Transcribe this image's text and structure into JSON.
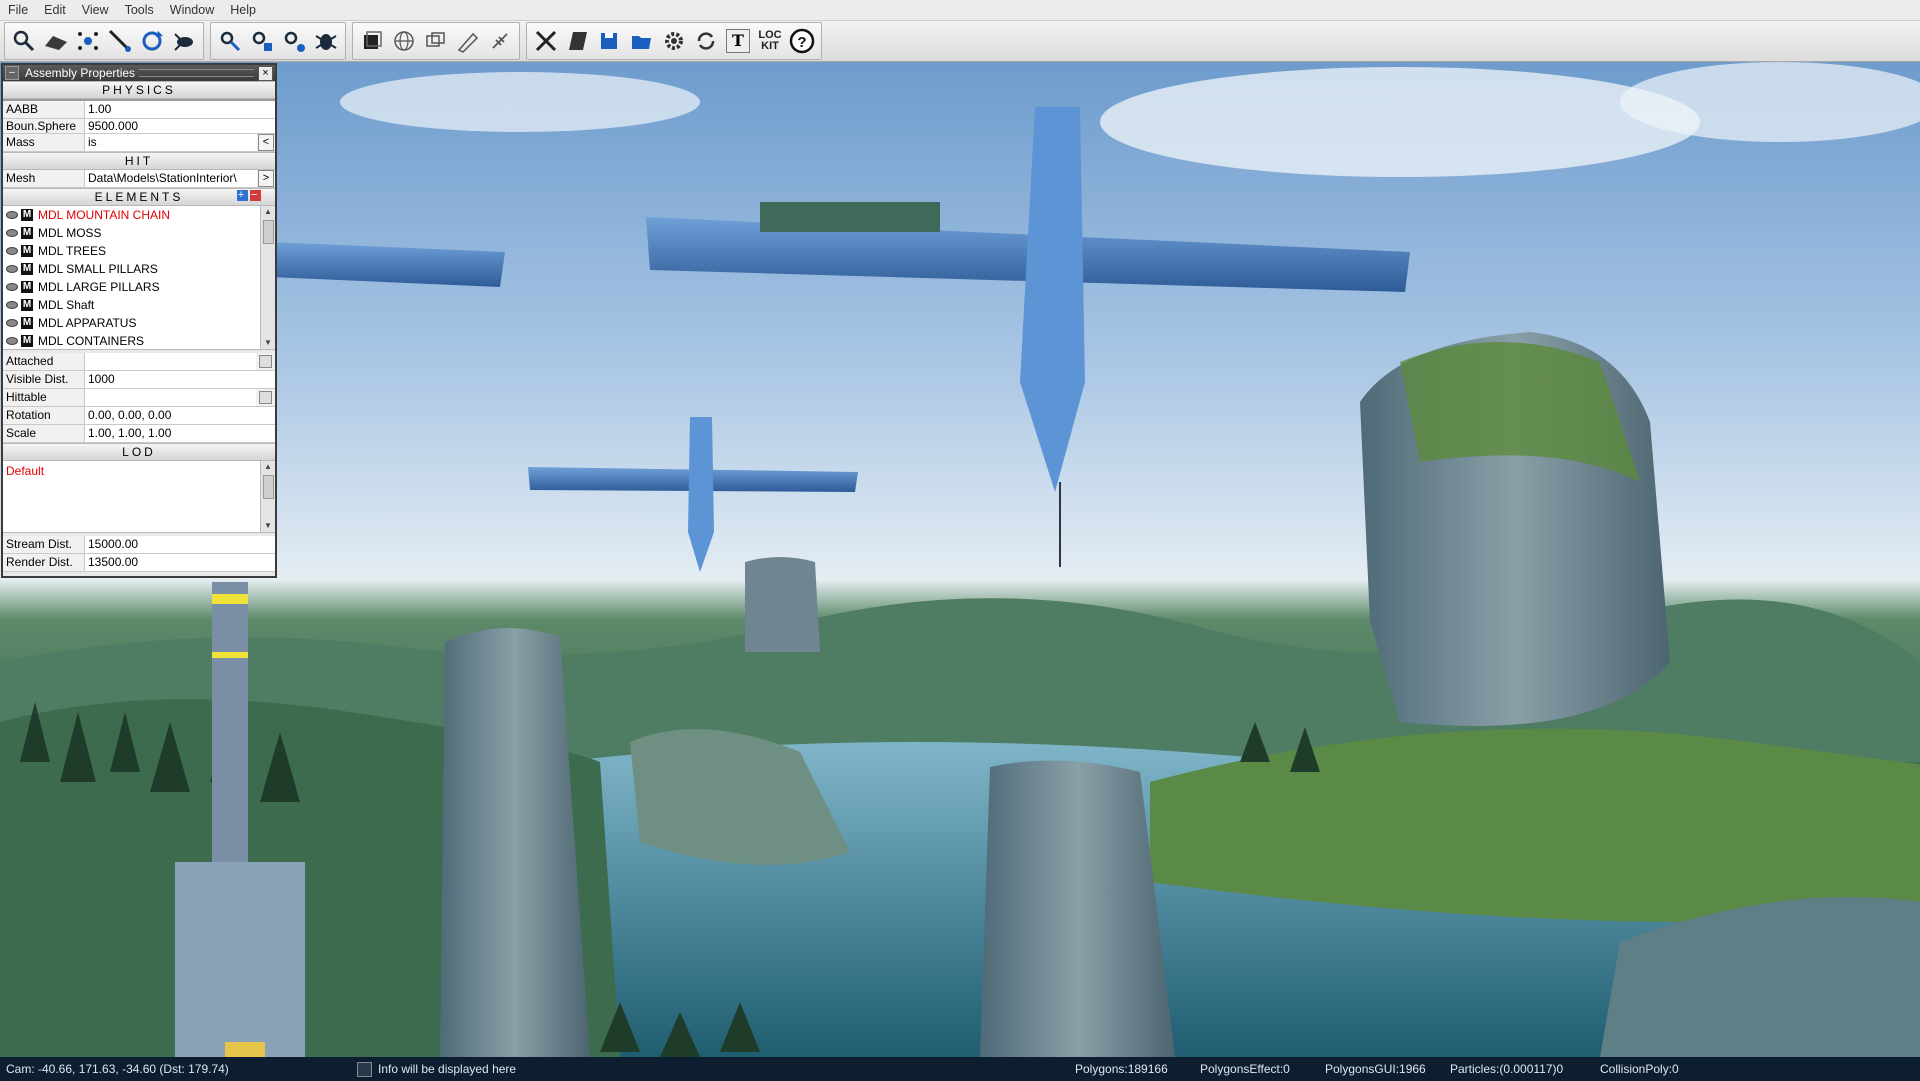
{
  "menu": [
    "File",
    "Edit",
    "View",
    "Tools",
    "Window",
    "Help"
  ],
  "toolbar": {
    "groups": [
      [
        "select-tool-icon",
        "terrain-tool-icon",
        "particle-tool-icon",
        "snap-tool-icon",
        "rotate-tool-icon",
        "creature-tool-icon"
      ],
      [
        "transform-tool-icon",
        "scale-tool-icon",
        "link-tool-icon",
        "debug-tool-icon"
      ],
      [
        "box-icon",
        "globe-icon",
        "layers-icon",
        "brush-icon",
        "tree-icon"
      ],
      [
        "tools-icon",
        "notes-icon",
        "save-icon",
        "open-folder-icon",
        "settings-gear-icon",
        "refresh-icon",
        "text-tool-icon",
        "loc-kit-icon",
        "help-icon"
      ]
    ],
    "loc_kit_line1": "LOC",
    "loc_kit_line2": "KIT",
    "text_tool_glyph": "T"
  },
  "panel": {
    "title": "Assembly Properties",
    "minimize": "–",
    "close": "×",
    "physics_header": "PHYSICS",
    "aabb_label": "AABB",
    "aabb_value": "1.00",
    "bound_sphere_label": "Boun.Sphere",
    "bound_sphere_value": "9500.000",
    "mass_label": "Mass",
    "mass_value": "is",
    "mass_button": "<",
    "hit_header": "HIT",
    "mesh_label": "Mesh",
    "mesh_value": "Data\\Models\\StationInterior\\",
    "mesh_button": ">",
    "elements_header": "ELEMENTS",
    "elements": [
      {
        "label": "MDL MOUNTAIN CHAIN",
        "selected": true
      },
      {
        "label": "MDL MOSS",
        "selected": false
      },
      {
        "label": "MDL TREES",
        "selected": false
      },
      {
        "label": "MDL SMALL PILLARS",
        "selected": false
      },
      {
        "label": "MDL LARGE PILLARS",
        "selected": false
      },
      {
        "label": "MDL Shaft",
        "selected": false
      },
      {
        "label": "MDL APPARATUS",
        "selected": false
      },
      {
        "label": "MDL CONTAINERS",
        "selected": false
      }
    ],
    "attached_label": "Attached",
    "visible_dist_label": "Visible Dist.",
    "visible_dist_value": "1000",
    "hittable_label": "Hittable",
    "rotation_label": "Rotation",
    "rotation_value": "0.00, 0.00, 0.00",
    "scale_label": "Scale",
    "scale_value": "1.00, 1.00, 1.00",
    "lod_header": "LOD",
    "lod_default": "Default",
    "stream_dist_label": "Stream Dist.",
    "stream_dist_value": "15000.00",
    "render_dist_label": "Render Dist.",
    "render_dist_value": "13500.00"
  },
  "status": {
    "cam": "Cam: -40.66, 171.63, -34.60 (Dst: 179.74)",
    "info": "Info will be displayed here",
    "polygons": "Polygons:189166",
    "polygons_effect": "PolygonsEffect:0",
    "polygons_gui": "PolygonsGUI:1966",
    "particles": "Particles:(0.000117)0",
    "collision_poly": "CollisionPoly:0"
  },
  "colors": {
    "selected_element": "#e00000",
    "status_bg": "#0d1e30",
    "panel_title_bg": "#3a3a3a"
  }
}
